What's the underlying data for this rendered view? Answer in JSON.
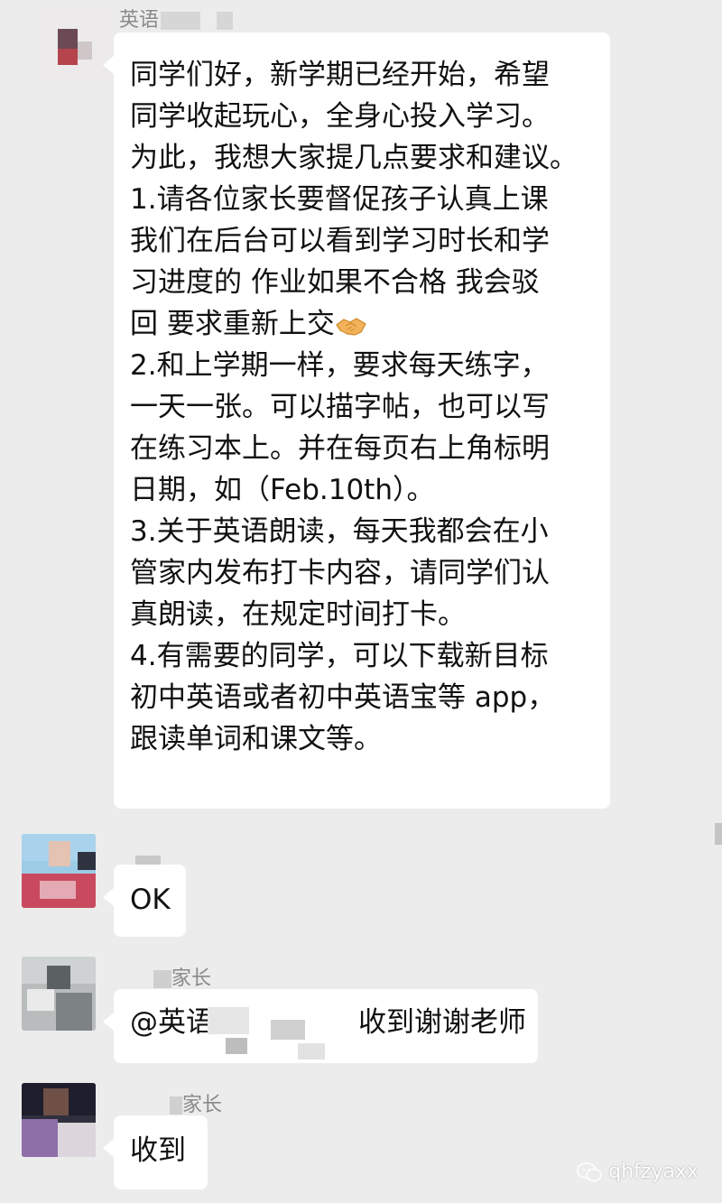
{
  "messages": [
    {
      "sender": "英语",
      "lines": [
        "同学们好，新学期已经开始，希望",
        "同学收起玩心，全身心投入学习。",
        "为此，我想大家提几点要求和建议。",
        "1.请各位家长要督促孩子认真上课",
        "我们在后台可以看到学习时长和学",
        "习进度的 作业如果不合格 我会驳",
        "回 要求重新上交",
        "2.和上学期一样，要求每天练字，",
        "一天一张。可以描字帖，也可以写",
        "在练习本上。并在每页右上角标明",
        "日期，如（Feb.10th）。",
        "3.关于英语朗读，每天我都会在小",
        "管家内发布打卡内容，请同学们认",
        "真朗读，在规定时间打卡。",
        "4.有需要的同学，可以下载新目标",
        "初中英语或者初中英语宝等 app，",
        "跟读单词和课文等。"
      ],
      "emoji_icon": "handshake-emoji"
    },
    {
      "sender": "",
      "text": "OK"
    },
    {
      "sender": "家长",
      "text_before": "@英语",
      "text_after": "收到谢谢老师"
    },
    {
      "sender": "家长",
      "text": "收到"
    }
  ],
  "watermark": {
    "text": "qhfzyaxx",
    "icon": "wechat-icon"
  }
}
